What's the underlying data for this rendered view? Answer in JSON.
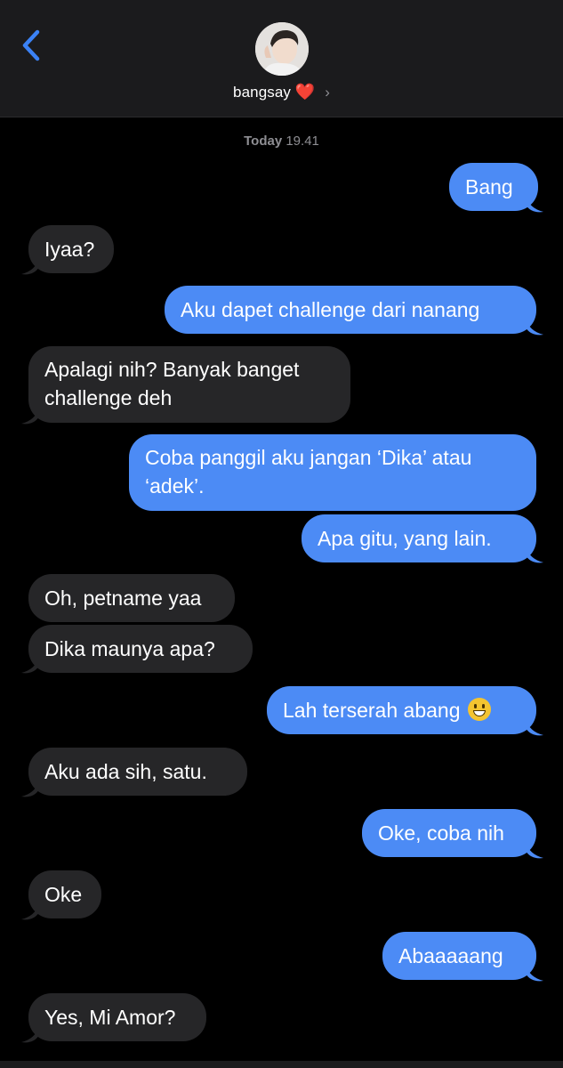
{
  "header": {
    "back_icon": "chevron-left-icon",
    "contact_name": "bangsay",
    "contact_emoji": "❤️",
    "chevron": "›"
  },
  "timestamp": {
    "day": "Today",
    "time": "19.41"
  },
  "colors": {
    "sent_bubble": "#4c8bf5",
    "received_bubble": "#262628",
    "background": "#000000"
  },
  "messages": [
    {
      "from": "me",
      "text": "Bang"
    },
    {
      "from": "them",
      "text": "Iyaa?"
    },
    {
      "from": "me",
      "text": "Aku dapet challenge dari nanang"
    },
    {
      "from": "them",
      "text": "Apalagi nih? Banyak banget challenge deh"
    },
    {
      "from": "me",
      "text": "Coba panggil aku jangan ‘Dika’ atau ‘adek’."
    },
    {
      "from": "me",
      "text": "Apa gitu, yang lain."
    },
    {
      "from": "them",
      "text": "Oh, petname yaa"
    },
    {
      "from": "them",
      "text": "Dika maunya apa?"
    },
    {
      "from": "me",
      "text": "Lah terserah abang",
      "emoji": "grinning-face-icon"
    },
    {
      "from": "them",
      "text": "Aku ada sih, satu."
    },
    {
      "from": "me",
      "text": "Oke, coba nih"
    },
    {
      "from": "them",
      "text": "Oke"
    },
    {
      "from": "me",
      "text": "Abaaaaang"
    },
    {
      "from": "them",
      "text": "Yes, Mi Amor?"
    }
  ]
}
